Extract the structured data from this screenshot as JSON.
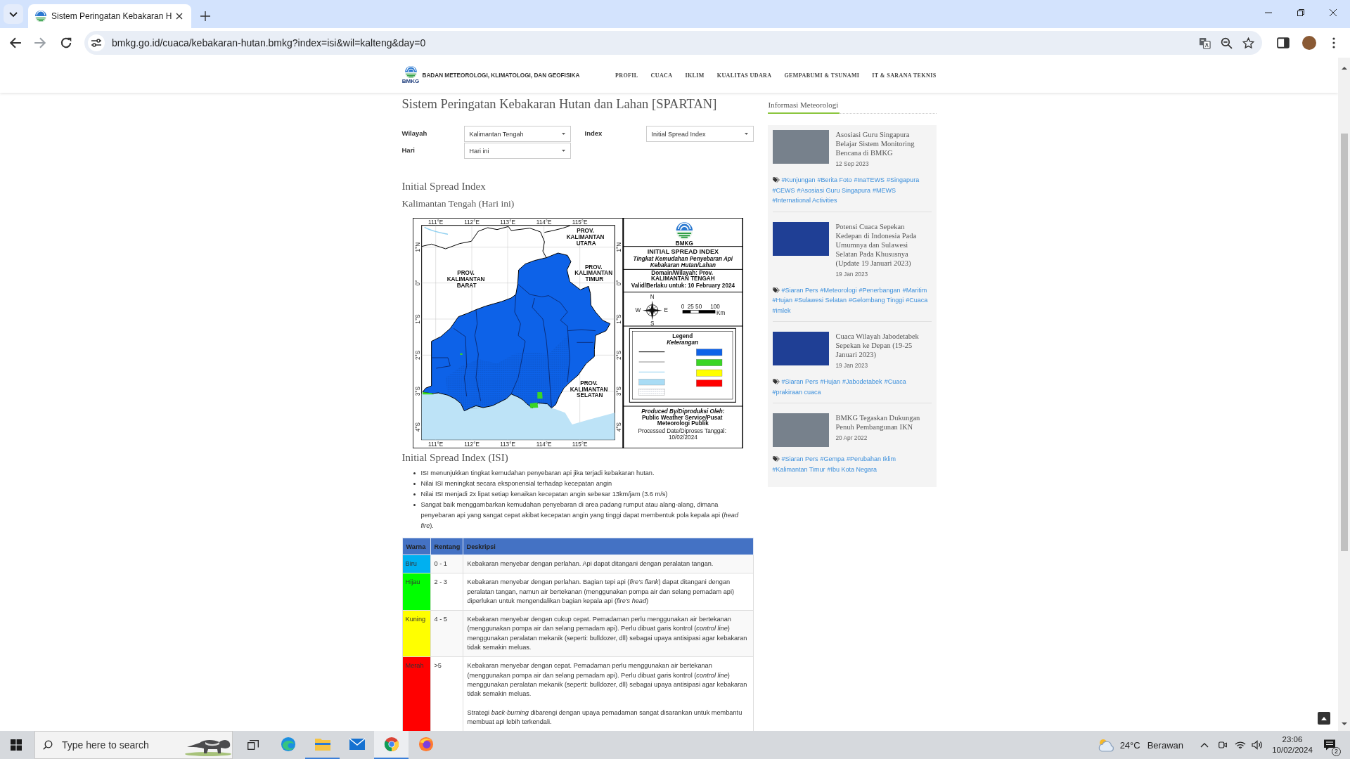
{
  "browser": {
    "tabs": [
      {
        "title": "Sistem Peringatan Kebakaran H",
        "selected": true
      }
    ],
    "url": "bmkg.go.id/cuaca/kebakaran-hutan.bmkg?index=isi&wil=kalteng&day=0"
  },
  "site_header": {
    "logo_text": "BMKG",
    "org_name": "BADAN METEOROLOGI, KLIMATOLOGI, DAN GEOFISIKA",
    "nav": [
      "PROFIL",
      "CUACA",
      "IKLIM",
      "KUALITAS UDARA",
      "GEMPABUMI & TSUNAMI",
      "IT & SARANA TEKNIS"
    ]
  },
  "page_title": "Sistem Peringatan Kebakaran Hutan dan Lahan [SPARTAN]",
  "filters": [
    {
      "label": "Wilayah",
      "value": "Kalimantan Tengah"
    },
    {
      "label": "Index",
      "value": "Initial Spread Index"
    },
    {
      "label": "Hari",
      "value": "Hari ini"
    }
  ],
  "map_section": {
    "heading": "Initial Spread Index",
    "subheading": "Kalimantan Tengah (Hari ini)"
  },
  "map": {
    "ticks": {
      "top": [
        "111°E",
        "112°E",
        "113°E",
        "114°E",
        "115°E"
      ],
      "bottom": [
        "111°E",
        "112°E",
        "113°E",
        "114°E",
        "115°E"
      ],
      "left": [
        "1°N",
        "0°",
        "1°S",
        "2°S",
        "3°S",
        "4°S"
      ],
      "right": [
        "1°N",
        "0°",
        "1°S",
        "2°S",
        "3°S",
        "4°S"
      ]
    },
    "province_labels": [
      "PROV. KALIMANTAN UTARA",
      "PROV. KALIMANTAN BARAT",
      "PROV. KALIMANTAN TIMUR",
      "PROV. KALIMANTAN SELATAN"
    ],
    "logo_text": "BMKG",
    "title": "INITIAL SPREAD INDEX",
    "subtitle": [
      "Tingkat Kemudahan Penyebaran Api",
      "Kebakaran Hutan/Lahan"
    ],
    "domain": "Domain/Wilayah: Prov. KALIMANTAN TENGAH",
    "valid": "Valid/Berlaku untuk: 10 February 2024",
    "compass": [
      "N",
      "E",
      "S",
      "W"
    ],
    "scale": [
      "0",
      "25",
      "50",
      "100"
    ],
    "scale_unit": "Km",
    "legend": {
      "title": "Legend",
      "subtitle": "Keterangan",
      "items": [
        {
          "kind": "boundary"
        },
        {
          "kind": "district"
        },
        {
          "kind": "river"
        },
        {
          "kind": "water"
        },
        {
          "kind": "peat"
        },
        {
          "kind": "class",
          "color": "#0d62e8"
        },
        {
          "kind": "class",
          "color": "#3ad624"
        },
        {
          "kind": "class",
          "color": "#ffff00"
        },
        {
          "kind": "class",
          "color": "#ff0000"
        }
      ]
    },
    "credits": [
      "Produced By/Diproduksi Oleh:",
      "Public Weather Service/Pusat Meteorologi Publik"
    ],
    "processed": "Processed Date/Diproses Tanggal: 10/02/2024"
  },
  "isi": {
    "heading": "Initial Spread Index (ISI)",
    "bullets": [
      "ISI menunjukkan tingkat kemudahan penyebaran api jika terjadi kebakaran hutan.",
      "Nilai ISI meningkat secara eksponensial terhadap kecepatan angin",
      "Nilai ISI menjadi 2x lipat setiap kenaikan kecepatan angin sebesar 13km/jam (3.6 m/s)",
      "Sangat baik menggambarkan kemudahan penyebaran di area padang rumput atau alang-alang, dimana penyebaran api yang sangat cepat akibat kecepatan angin yang tinggi dapat membentuk pola kepala api (*head fire*)."
    ],
    "table": {
      "columns": [
        "Warna",
        "Rentang",
        "Deskripsi"
      ],
      "rows": [
        {
          "warna": "Biru",
          "color": "#00b0f0",
          "rentang": "0 - 1",
          "deskripsi": [
            "Kebakaran menyebar dengan perlahan. Api dapat ditangani dengan peralatan tangan."
          ]
        },
        {
          "warna": "Hijau",
          "color": "#00ff00",
          "rentang": "2 - 3",
          "deskripsi": [
            "Kebakaran menyebar dengan perlahan. Bagian tepi api (*fire's flank*) dapat ditangani dengan peralatan tangan, namun air bertekanan (menggunakan pompa air dan selang pemadam api) diperlukan untuk mengendalikan bagian kepala api (*fire's head*)"
          ]
        },
        {
          "warna": "Kuning",
          "color": "#ffff00",
          "rentang": "4 - 5",
          "deskripsi": [
            "Kebakaran menyebar dengan cukup cepat. Pemadaman perlu menggunakan air bertekanan (menggunakan pompa air dan selang pemadam api). Perlu dibuat garis kontrol (*control line*) menggunakan peralatan mekanik (seperti: bulldozer, dll) sebagai upaya antisipasi agar kebakaran tidak semakin meluas."
          ]
        },
        {
          "warna": "Merah",
          "color": "#ff0000",
          "rentang": ">5",
          "deskripsi": [
            "Kebakaran menyebar dengan cepat. Pemadaman perlu menggunakan air bertekanan (menggunakan pompa air dan selang pemadam api). Perlu dibuat garis kontrol (*control line*) menggunakan peralatan mekanik (seperti: bulldozer, dll) sebagai upaya antisipasi agar kebakaran tidak semakin meluas.",
            "Strategi *back-burning* dibarengi dengan upaya pemadaman sangat disarankan untuk membantu membuat api lebih terkendali."
          ]
        }
      ]
    }
  },
  "sidebar": {
    "heading": "Informasi Meteorologi",
    "posts": [
      {
        "kind": "photo",
        "title": "Asosiasi Guru Singapura Belajar Sistem Monitoring Bencana di BMKG",
        "date": "12 Sep 2023",
        "tags": [
          "#Kunjungan",
          "#Berita Foto",
          "#InaTEWS",
          "#Singapura",
          "#CEWS",
          "#Asosiasi Guru Singapura",
          "#MEWS",
          "#International Activities"
        ]
      },
      {
        "kind": "map",
        "title": "Potensi Cuaca Sepekan Kedepan di Indonesia Pada Umumnya dan Sulawesi Selatan Pada Khususnya (Update 19 Januari 2023)",
        "date": "19 Jan 2023",
        "tags": [
          "#Siaran Pers",
          "#Meteorologi",
          "#Penerbangan",
          "#Maritim",
          "#Hujan",
          "#Sulawesi Selatan",
          "#Gelombang Tinggi",
          "#Cuaca",
          "#imlek"
        ]
      },
      {
        "kind": "map",
        "title": "Cuaca Wilayah Jabodetabek Sepekan ke Depan (19-25 Januari 2023)",
        "date": "19 Jan 2023",
        "tags": [
          "#Siaran Pers",
          "#Hujan",
          "#Jabodetabek",
          "#Cuaca",
          "#prakiraan cuaca"
        ]
      },
      {
        "kind": "photo",
        "title": "BMKG Tegaskan Dukungan Penuh Pembangunan IKN",
        "date": "20 Apr 2022",
        "tags": [
          "#Siaran Pers",
          "#Gempa",
          "#Perubahan Iklim",
          "#Kalimantan Timur",
          "#Ibu Kota Negara"
        ]
      }
    ]
  },
  "taskbar": {
    "search_placeholder": "Type here to search",
    "apps": [
      {
        "running": false,
        "selected": false
      },
      {
        "running": true,
        "selected": false
      },
      {
        "running": false,
        "selected": false
      },
      {
        "running": true,
        "selected": true
      },
      {
        "running": false,
        "selected": false
      }
    ],
    "weather": {
      "temperature": "24°C",
      "condition": "Berawan"
    },
    "time": "23:06",
    "date": "10/02/2024",
    "notifications": "2"
  }
}
